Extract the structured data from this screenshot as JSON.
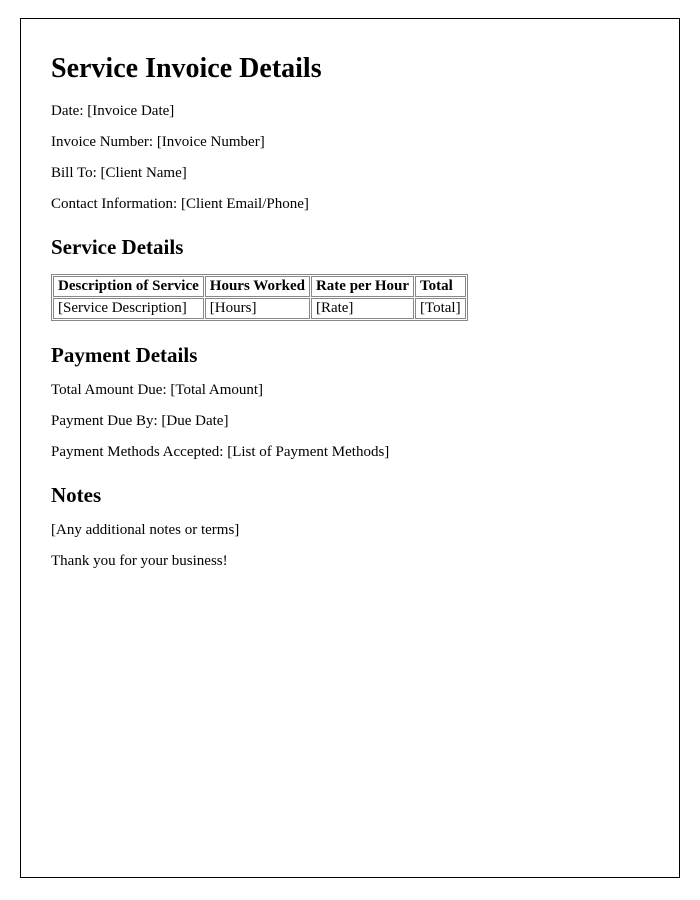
{
  "title": "Service Invoice Details",
  "header": {
    "date_label": "Date: ",
    "date_value": "[Invoice Date]",
    "invoice_number_label": "Invoice Number: ",
    "invoice_number_value": "[Invoice Number]",
    "bill_to_label": "Bill To: ",
    "bill_to_value": "[Client Name]",
    "contact_label": "Contact Information: ",
    "contact_value": "[Client Email/Phone]"
  },
  "service_details": {
    "heading": "Service Details",
    "columns": {
      "description": "Description of Service",
      "hours": "Hours Worked",
      "rate": "Rate per Hour",
      "total": "Total"
    },
    "row": {
      "description": "[Service Description]",
      "hours": "[Hours]",
      "rate": "[Rate]",
      "total": "[Total]"
    }
  },
  "payment_details": {
    "heading": "Payment Details",
    "total_due_label": "Total Amount Due: ",
    "total_due_value": "[Total Amount]",
    "due_by_label": "Payment Due By: ",
    "due_by_value": "[Due Date]",
    "methods_label": "Payment Methods Accepted: ",
    "methods_value": "[List of Payment Methods]"
  },
  "notes": {
    "heading": "Notes",
    "additional": "[Any additional notes or terms]",
    "thanks": "Thank you for your business!"
  }
}
